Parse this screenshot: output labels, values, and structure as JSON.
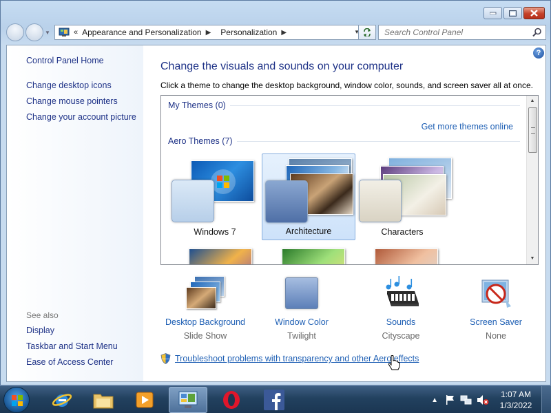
{
  "window": {
    "breadcrumb": [
      "Appearance and Personalization",
      "Personalization"
    ],
    "search_placeholder": "Search Control Panel"
  },
  "sidebar": {
    "home": "Control Panel Home",
    "tasks": [
      "Change desktop icons",
      "Change mouse pointers",
      "Change your account picture"
    ],
    "see_also_label": "See also",
    "see_also": [
      "Display",
      "Taskbar and Start Menu",
      "Ease of Access Center"
    ]
  },
  "main": {
    "heading": "Change the visuals and sounds on your computer",
    "instruction": "Click a theme to change the desktop background, window color, sounds, and screen saver all at once.",
    "my_themes": "My Themes (0)",
    "get_more": "Get more themes online",
    "aero_themes": "Aero Themes (7)",
    "themes": [
      "Windows 7",
      "Architecture",
      "Characters"
    ],
    "selected_theme": "Architecture",
    "bottom": [
      {
        "title": "Desktop Background",
        "value": "Slide Show",
        "icon": "desktop-background-icon"
      },
      {
        "title": "Window Color",
        "value": "Twilight",
        "icon": "window-color-icon"
      },
      {
        "title": "Sounds",
        "value": "Cityscape",
        "icon": "sounds-icon"
      },
      {
        "title": "Screen Saver",
        "value": "None",
        "icon": "screen-saver-icon"
      }
    ],
    "troubleshoot": "Troubleshoot problems with transparency and other Aero effects"
  },
  "taskbar": {
    "apps": [
      "internet-explorer-icon",
      "windows-explorer-icon",
      "media-player-icon",
      "control-panel-icon",
      "opera-icon",
      "facebook-icon"
    ],
    "active_app": "control-panel-icon",
    "time": "1:07 AM",
    "date": "1/3/2022"
  },
  "colors": {
    "link": "#1e3287",
    "link_blue": "#1e5fb4",
    "taskbar": "#22415f"
  }
}
